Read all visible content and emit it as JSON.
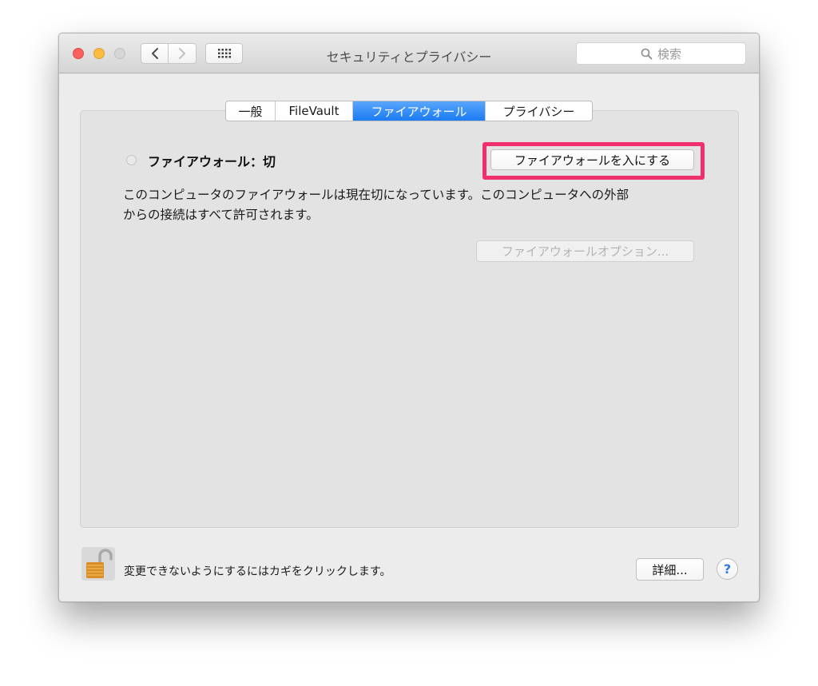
{
  "window": {
    "title": "セキュリティとプライバシー",
    "search_placeholder": "検索"
  },
  "tabs": [
    {
      "label": "一般",
      "active": false
    },
    {
      "label": "FileVault",
      "active": false
    },
    {
      "label": "ファイアウォール",
      "active": true
    },
    {
      "label": "プライバシー",
      "active": false
    }
  ],
  "firewall": {
    "status_label": "ファイアウォール：切",
    "enable_button": "ファイアウォールを入にする",
    "description_line1": "このコンピュータのファイアウォールは現在切になっています。このコンピュータへの外部",
    "description_line2": "からの接続はすべて許可されます。",
    "options_button": "ファイアウォールオプション...",
    "options_enabled": false
  },
  "footer": {
    "lock_hint": "変更できないようにするにはカギをクリックします。",
    "details_button": "詳細...",
    "help_label": "?"
  },
  "colors": {
    "highlight": "#f0306d",
    "tab_active": "#1a7bf3",
    "close": "#fc605b",
    "minimize": "#fdbc40"
  },
  "icons": [
    "close-icon",
    "minimize-icon",
    "zoom-icon",
    "back-chevron-icon",
    "forward-chevron-icon",
    "grid-icon",
    "search-icon",
    "lock-icon",
    "help-icon"
  ]
}
